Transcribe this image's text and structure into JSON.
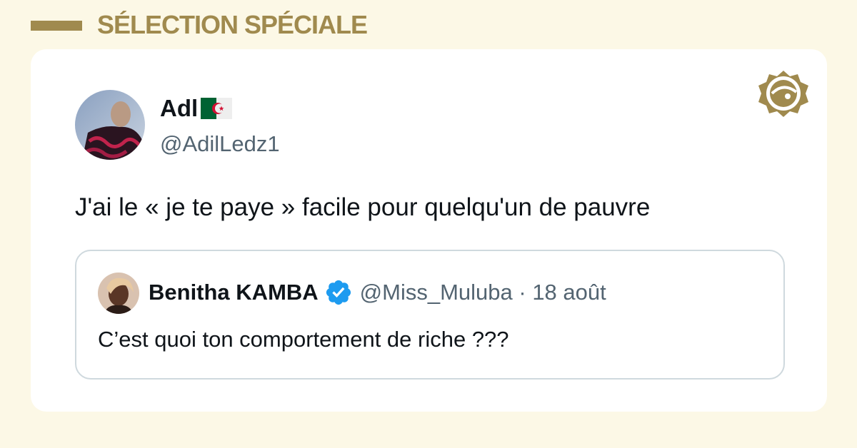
{
  "header": {
    "title": "SÉLECTION SPÉCIALE"
  },
  "tweet": {
    "author_name": "Adl",
    "author_handle": "@AdilLedz1",
    "flag_icon": "algeria-flag-icon",
    "text": "J'ai le « je te paye » facile pour quelqu'un de pauvre",
    "quote": {
      "author_name": "Benitha KAMBA",
      "verified_icon": "verified-badge-icon",
      "meta": "@Miss_Muluba · 18 août",
      "text": "C’est quoi ton comportement de riche ???"
    }
  },
  "colors": {
    "background": "#fcf8e6",
    "accent": "#a08a4e",
    "verified": "#1d9bf0",
    "text": "#0f1419",
    "muted": "#536471"
  }
}
